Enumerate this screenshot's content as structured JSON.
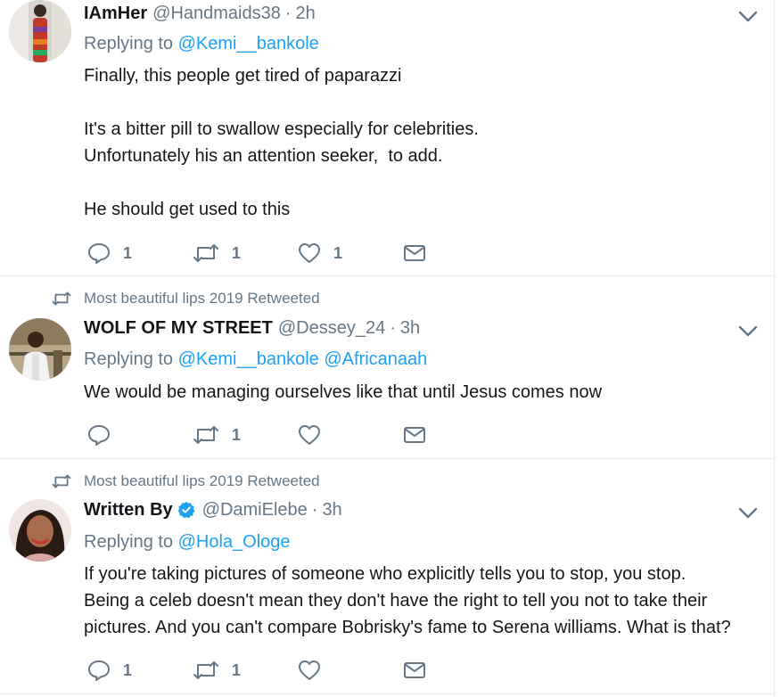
{
  "tweets": [
    {
      "retweet_context": "",
      "name": "IAmHer",
      "handle": "@Handmaids38",
      "separator": "·",
      "time": "2h",
      "verified": false,
      "replying_prefix": "Replying to",
      "replying_to": [
        "@Kemi__bankole"
      ],
      "text": "Finally, this people get tired of paparazzi\n\nIt's a bitter pill to swallow especially for celebrities.\nUnfortunately his an attention seeker,  to add.\n\nHe should get used to this",
      "reply_count": "1",
      "retweet_count": "1",
      "like_count": "1"
    },
    {
      "retweet_context": "Most beautiful lips 2019 Retweeted",
      "name": "WOLF OF MY STREET",
      "handle": "@Dessey_24",
      "separator": "·",
      "time": "3h",
      "verified": false,
      "replying_prefix": "Replying to",
      "replying_to": [
        "@Kemi__bankole",
        "@Africanaah"
      ],
      "text": "We would be managing ourselves like that until Jesus comes now",
      "reply_count": "",
      "retweet_count": "1",
      "like_count": ""
    },
    {
      "retweet_context": "Most beautiful lips 2019 Retweeted",
      "name": "Written By",
      "handle": "@DamiElebe",
      "separator": "·",
      "time": "3h",
      "verified": true,
      "replying_prefix": "Replying to",
      "replying_to": [
        "@Hola_Ologe"
      ],
      "text": "If you're taking pictures of someone who explicitly tells you to stop, you stop.\nBeing a celeb doesn't mean they don't have the right to tell you not to take their\npictures. And you can't compare Bobrisky's fame to Serena williams. What is that?",
      "reply_count": "1",
      "retweet_count": "1",
      "like_count": ""
    }
  ],
  "icons": {
    "reply": "reply-icon",
    "retweet": "retweet-icon",
    "like": "heart-icon",
    "dm": "envelope-icon",
    "caret": "chevron-down-icon",
    "verified": "verified-badge-icon"
  },
  "colors": {
    "link": "#1da1f2",
    "muted": "#657786",
    "text": "#14171a",
    "divider": "#e6ecf0"
  }
}
